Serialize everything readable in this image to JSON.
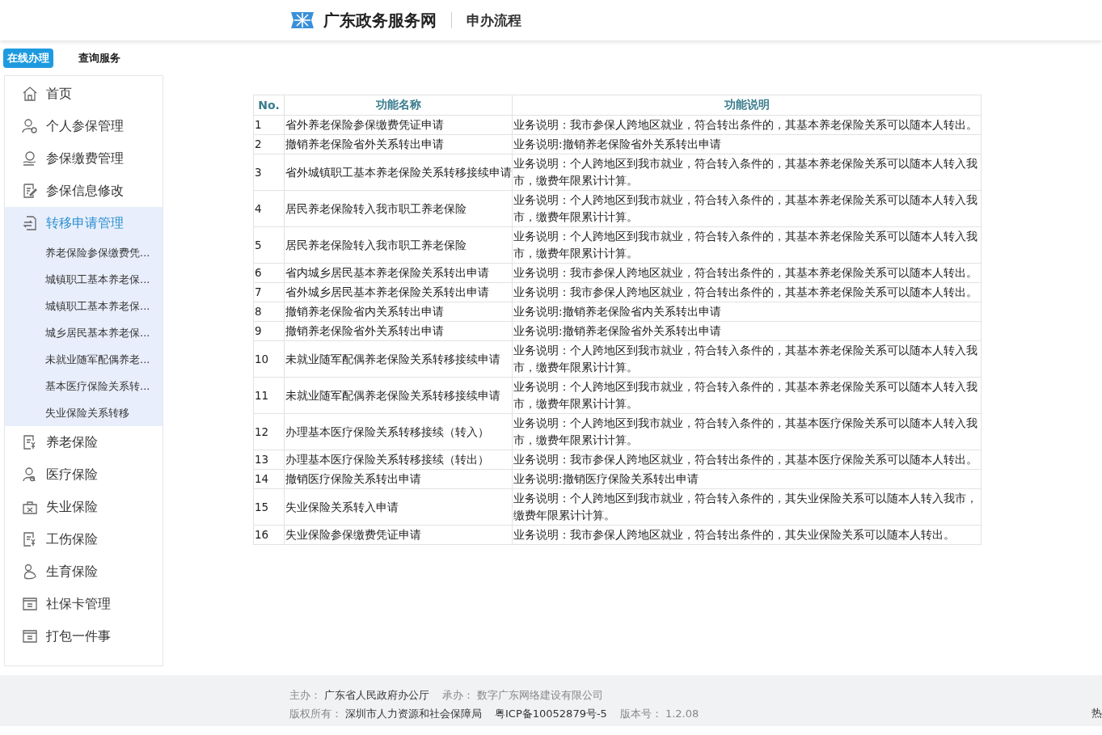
{
  "header": {
    "site_title": "广东政务服务网",
    "page_title": "申办流程"
  },
  "top_tabs": [
    {
      "label": "在线办理",
      "selected": true
    },
    {
      "label": "查询服务",
      "selected": false
    }
  ],
  "sidebar": {
    "items": [
      {
        "label": "首页",
        "selected": false,
        "expanded": false
      },
      {
        "label": "个人参保管理",
        "selected": false,
        "expanded": false
      },
      {
        "label": "参保缴费管理",
        "selected": false,
        "expanded": false
      },
      {
        "label": "参保信息修改",
        "selected": false,
        "expanded": false
      },
      {
        "label": "转移申请管理",
        "selected": true,
        "expanded": true,
        "children": [
          {
            "label": "养老保险参保缴费凭..."
          },
          {
            "label": "城镇职工基本养老保..."
          },
          {
            "label": "城镇职工基本养老保..."
          },
          {
            "label": "城乡居民基本养老保..."
          },
          {
            "label": "未就业随军配偶养老..."
          },
          {
            "label": "基本医疗保险关系转..."
          },
          {
            "label": "失业保险关系转移"
          }
        ]
      },
      {
        "label": "养老保险",
        "selected": false,
        "expanded": false
      },
      {
        "label": "医疗保险",
        "selected": false,
        "expanded": false
      },
      {
        "label": "失业保险",
        "selected": false,
        "expanded": false
      },
      {
        "label": "工伤保险",
        "selected": false,
        "expanded": false
      },
      {
        "label": "生育保险",
        "selected": false,
        "expanded": false
      },
      {
        "label": "社保卡管理",
        "selected": false,
        "expanded": false
      },
      {
        "label": "打包一件事",
        "selected": false,
        "expanded": false
      }
    ]
  },
  "table": {
    "columns": [
      "No.",
      "功能名称",
      "功能说明"
    ],
    "rows": [
      [
        "1",
        "省外养老保险参保缴费凭证申请",
        "业务说明：我市参保人跨地区就业，符合转出条件的，其基本养老保险关系可以随本人转出。"
      ],
      [
        "2",
        "撤销养老保险省外关系转出申请",
        "业务说明:撤销养老保险省外关系转出申请"
      ],
      [
        "3",
        "省外城镇职工基本养老保险关系转移接续申请",
        "业务说明：个人跨地区到我市就业，符合转入条件的，其基本养老保险关系可以随本人转入我市，缴费年限累计计算。"
      ],
      [
        "4",
        "居民养老保险转入我市职工养老保险",
        "业务说明：个人跨地区到我市就业，符合转入条件的，其基本养老保险关系可以随本人转入我市，缴费年限累计计算。"
      ],
      [
        "5",
        "居民养老保险转入我市职工养老保险",
        "业务说明：个人跨地区到我市就业，符合转入条件的，其基本养老保险关系可以随本人转入我市，缴费年限累计计算。"
      ],
      [
        "6",
        "省内城乡居民基本养老保险关系转出申请",
        "业务说明：我市参保人跨地区就业，符合转出条件的，其基本养老保险关系可以随本人转出。"
      ],
      [
        "7",
        "省外城乡居民基本养老保险关系转出申请",
        "业务说明：我市参保人跨地区就业，符合转出条件的，其基本养老保险关系可以随本人转出。"
      ],
      [
        "8",
        "撤销养老保险省内关系转出申请",
        "业务说明:撤销养老保险省内关系转出申请"
      ],
      [
        "9",
        "撤销养老保险省外关系转出申请",
        "业务说明:撤销养老保险省外关系转出申请"
      ],
      [
        "10",
        "未就业随军配偶养老保险关系转移接续申请",
        "业务说明：个人跨地区到我市就业，符合转入条件的，其基本养老保险关系可以随本人转入我市，缴费年限累计计算。"
      ],
      [
        "11",
        "未就业随军配偶养老保险关系转移接续申请",
        "业务说明：个人跨地区到我市就业，符合转入条件的，其基本养老保险关系可以随本人转入我市，缴费年限累计计算。"
      ],
      [
        "12",
        "办理基本医疗保险关系转移接续（转入）",
        "业务说明：个人跨地区到我市就业，符合转入条件的，其基本医疗保险关系可以随本人转入我市，缴费年限累计计算。"
      ],
      [
        "13",
        "办理基本医疗保险关系转移接续（转出）",
        "业务说明：我市参保人跨地区就业，符合转出条件的，其基本医疗保险关系可以随本人转出。"
      ],
      [
        "14",
        "撤销医疗保险关系转出申请",
        "业务说明:撤销医疗保险关系转出申请"
      ],
      [
        "15",
        "失业保险关系转入申请",
        "业务说明：个人跨地区到我市就业，符合转入条件的，其失业保险关系可以随本人转入我市，缴费年限累计计算。"
      ],
      [
        "16",
        "失业保险参保缴费凭证申请",
        "业务说明：我市参保人跨地区就业，符合转出条件的，其失业保险关系可以随本人转出。"
      ]
    ]
  },
  "footer": {
    "lines": [
      [
        {
          "label": "主办：",
          "value": "广东省人民政府办公厅"
        },
        {
          "label": "承办：",
          "value": "数字广东网络建设有限公司"
        }
      ],
      [
        {
          "label": "版权所有：",
          "value": "深圳市人力资源和社会保障局"
        },
        {
          "value": "粤ICP备10052879号-5"
        },
        {
          "label": "版本号：",
          "value": "1.2.08"
        }
      ]
    ],
    "hotline": "热"
  }
}
